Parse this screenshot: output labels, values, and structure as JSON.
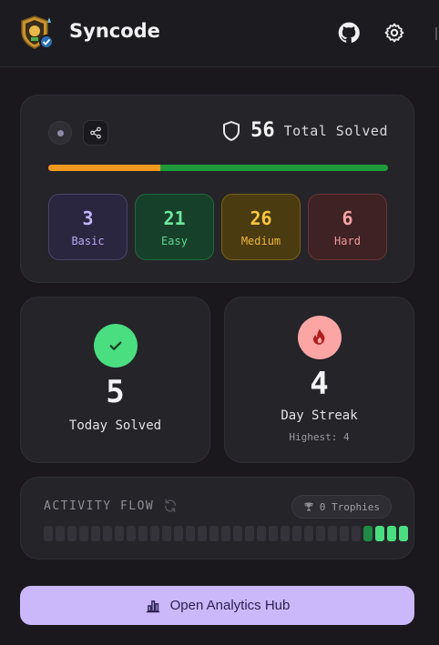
{
  "app": {
    "title": "Syncode"
  },
  "header": {
    "github_icon": "github-icon",
    "settings_icon": "gear-icon"
  },
  "summary": {
    "total_solved": "56",
    "total_label": "Total Solved",
    "progress": {
      "first_segment_fraction": 0.33,
      "colors": [
        "#f39a1e",
        "#1e9b3a"
      ]
    },
    "difficulties": [
      {
        "count": "3",
        "label": "Basic"
      },
      {
        "count": "21",
        "label": "Easy"
      },
      {
        "count": "26",
        "label": "Medium"
      },
      {
        "count": "6",
        "label": "Hard"
      }
    ]
  },
  "today": {
    "value": "5",
    "label": "Today Solved"
  },
  "streak": {
    "value": "4",
    "label": "Day Streak",
    "highest": "Highest: 4"
  },
  "activity": {
    "title": "ACTIVITY FLOW",
    "trophies": "0 Trophies",
    "cells": [
      0,
      0,
      0,
      0,
      0,
      0,
      0,
      0,
      0,
      0,
      0,
      0,
      0,
      0,
      0,
      0,
      0,
      0,
      0,
      0,
      0,
      0,
      0,
      0,
      0,
      0,
      0,
      1,
      2,
      2,
      2
    ]
  },
  "cta": {
    "label": "Open Analytics Hub"
  },
  "colors": {
    "accent": "#cbb8fb",
    "easy": "#4ade80",
    "fire": "#fca5a5"
  }
}
